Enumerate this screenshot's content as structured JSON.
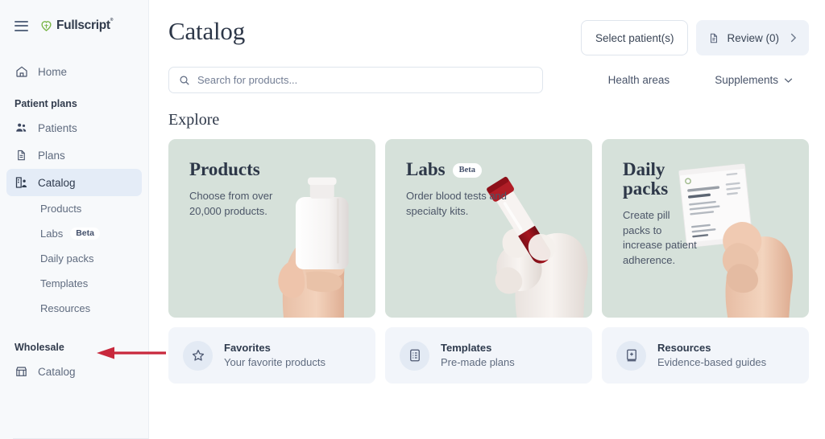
{
  "brand": {
    "name": "Fullscript",
    "logo_mark": "leaf-heart-icon",
    "menu_icon": "hamburger-icon"
  },
  "sidebar": {
    "home": {
      "label": "Home",
      "icon": "home-icon"
    },
    "groups": [
      {
        "title": "Patient plans",
        "items": [
          {
            "label": "Patients",
            "icon": "patients-icon",
            "active": false
          },
          {
            "label": "Plans",
            "icon": "document-icon",
            "active": false
          },
          {
            "label": "Catalog",
            "icon": "catalog-icon",
            "active": true
          }
        ],
        "subitems": [
          {
            "label": "Products",
            "badge": ""
          },
          {
            "label": "Labs",
            "badge": "Beta"
          },
          {
            "label": "Daily packs",
            "badge": ""
          },
          {
            "label": "Templates",
            "badge": ""
          },
          {
            "label": "Resources",
            "badge": ""
          }
        ]
      },
      {
        "title": "Wholesale",
        "items": [
          {
            "label": "Catalog",
            "icon": "store-icon",
            "active": false
          }
        ],
        "subitems": []
      }
    ]
  },
  "header": {
    "title": "Catalog",
    "select_patients_label": "Select patient(s)",
    "review_label": "Review (0)",
    "review_icon": "document-icon",
    "review_chevron": "chevron-right-icon"
  },
  "search": {
    "placeholder": "Search for products...",
    "value": "",
    "icon": "search-icon"
  },
  "filters": [
    {
      "label": "Health areas",
      "icon": "chevron-down-icon"
    },
    {
      "label": "Supplements",
      "icon": "chevron-down-icon"
    }
  ],
  "explore": {
    "heading": "Explore",
    "cards": [
      {
        "title": "Products",
        "badge": "",
        "desc": "Choose from over 20,000 products.",
        "image": "hand-holding-supplement-bottle",
        "bg": "#d6e1da"
      },
      {
        "title": "Labs",
        "badge": "Beta",
        "desc": "Order blood tests and specialty kits.",
        "image": "gloved-hand-holding-blood-vial",
        "bg": "#d6e1da"
      },
      {
        "title": "Daily packs",
        "badge": "",
        "desc": "Create pill packs to increase patient adherence.",
        "image": "hand-holding-pill-pack-sachet",
        "bg": "#d6e1da"
      }
    ]
  },
  "quick_links": [
    {
      "title": "Favorites",
      "subtitle": "Your favorite products",
      "icon": "star-icon"
    },
    {
      "title": "Templates",
      "subtitle": "Pre-made plans",
      "icon": "list-document-icon"
    },
    {
      "title": "Resources",
      "subtitle": "Evidence-based guides",
      "icon": "book-plus-icon"
    }
  ],
  "annotation": {
    "type": "arrow",
    "color": "#c8283c",
    "points_to": "Resources"
  },
  "colors": {
    "sidebar_bg": "#f7f9fb",
    "active_nav": "#e4ecf7",
    "card_green": "#d6e1da",
    "quick_card": "#f2f5fa",
    "brand_green": "#7ab648",
    "text_dark": "#2d3748",
    "text_muted": "#5f6b7f"
  }
}
